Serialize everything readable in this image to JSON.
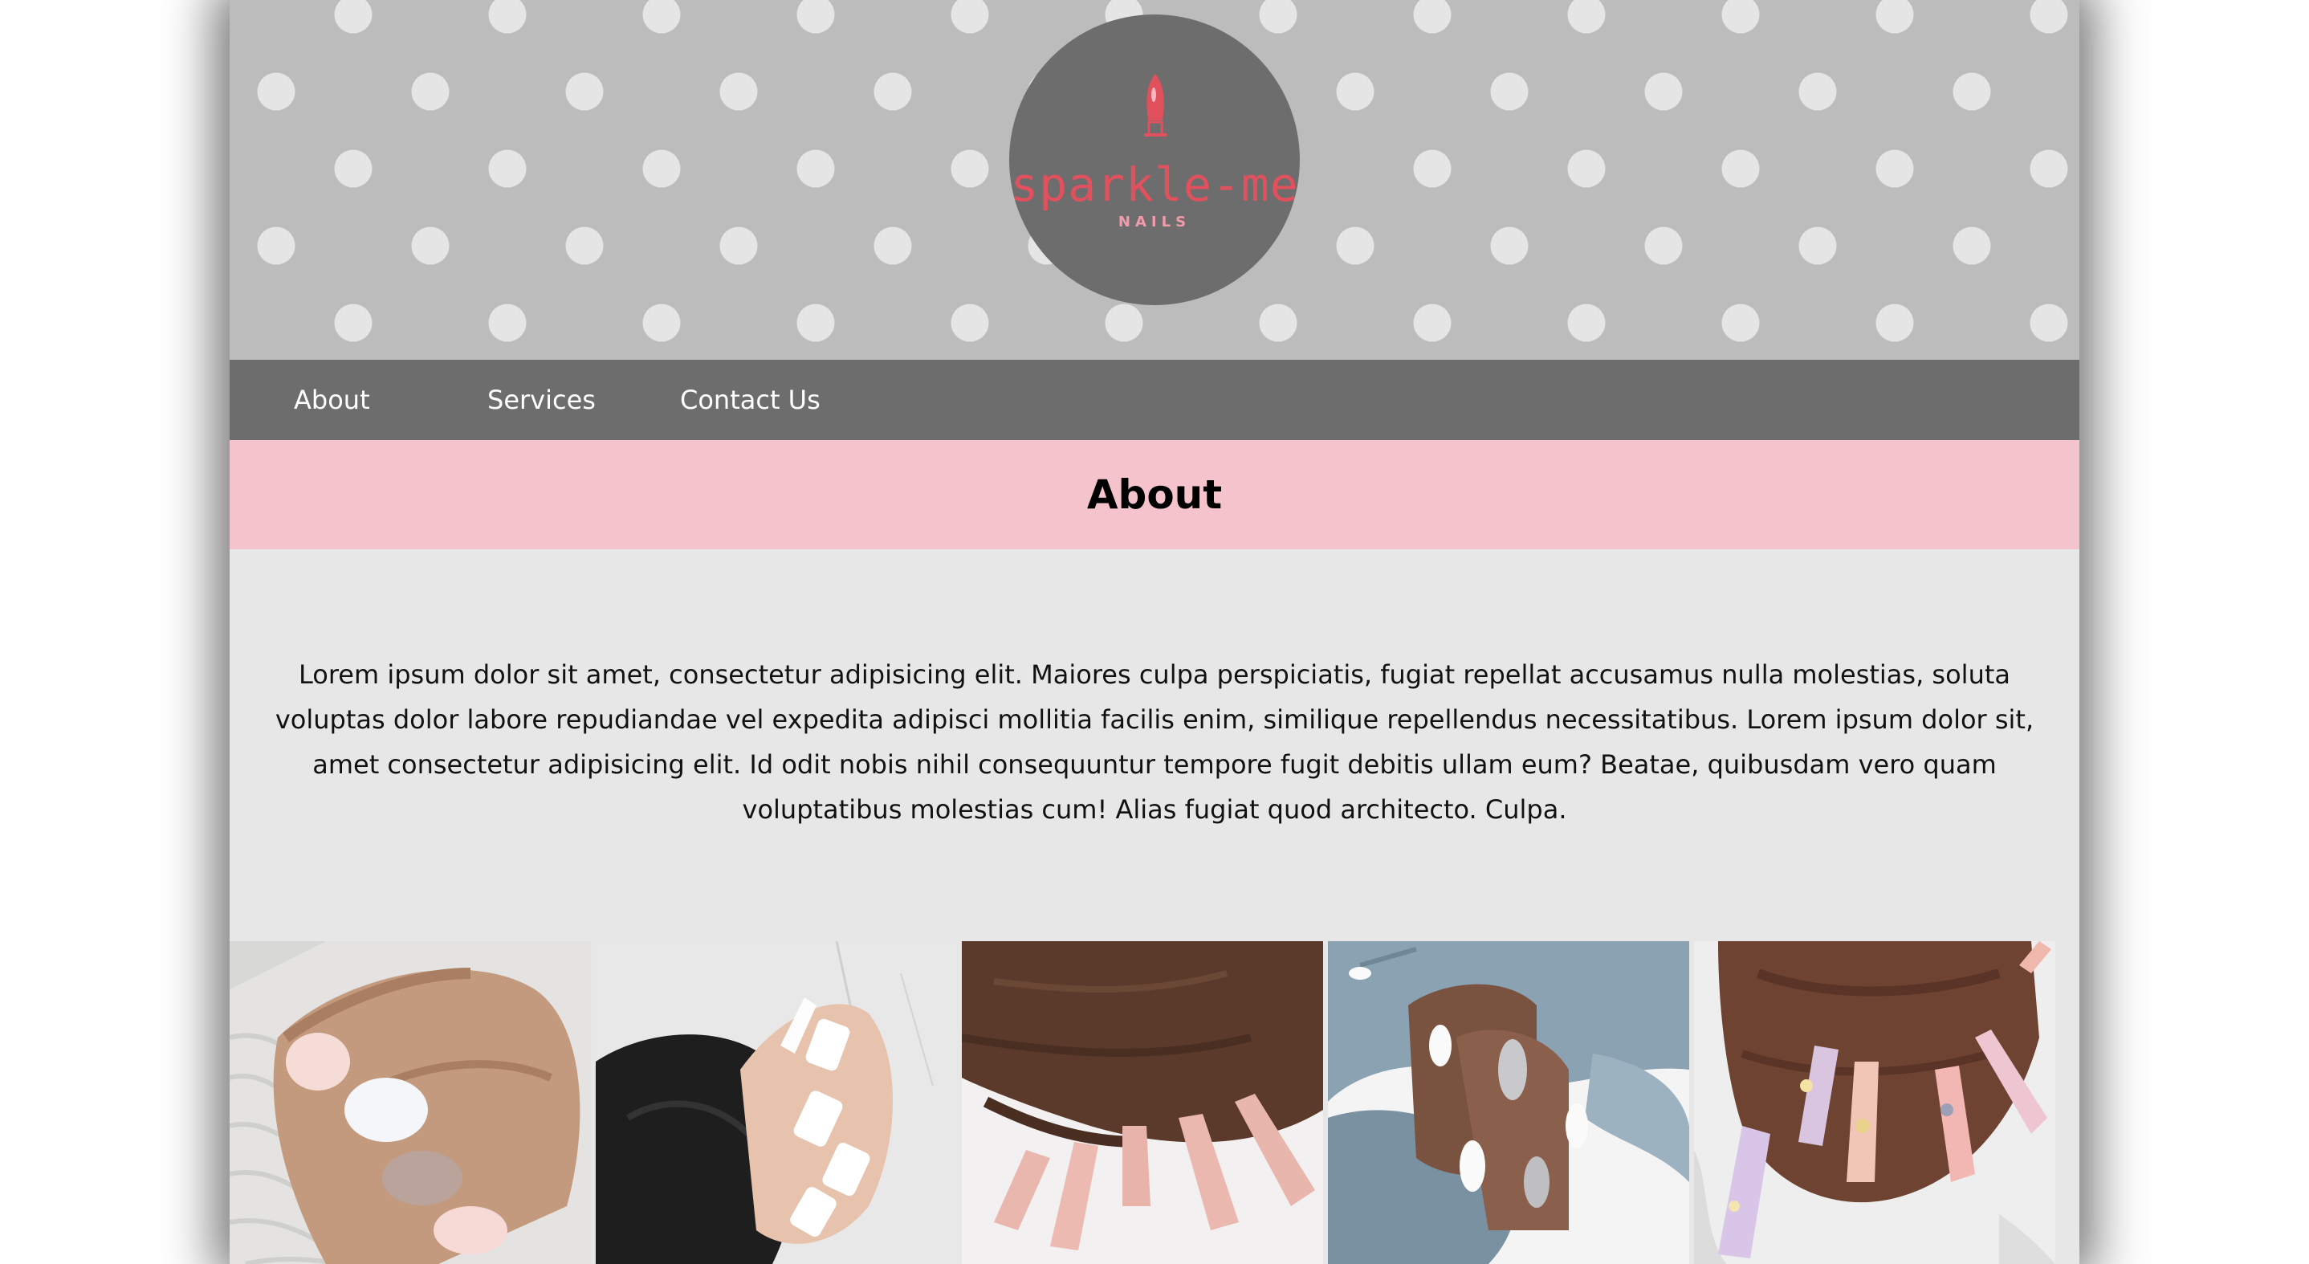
{
  "brand": {
    "name": "sparkle-me",
    "tagline": "NAILS",
    "colors": {
      "accent": "#e0505d",
      "pink_band": "#f5c3cc",
      "nav": "#6e6d6e",
      "header": "#bdbcbd"
    }
  },
  "nav": {
    "items": [
      {
        "label": "About"
      },
      {
        "label": "Services"
      },
      {
        "label": "Contact Us"
      }
    ]
  },
  "about": {
    "heading": "About",
    "body": "Lorem ipsum dolor sit amet, consectetur adipisicing elit. Maiores culpa perspiciatis, fugiat repellat accusamus nulla molestias, soluta voluptas dolor labore repudiandae vel expedita adipisci mollitia facilis enim, similique repellendus necessitatibus. Lorem ipsum dolor sit, amet consectetur adipisicing elit. Id odit nobis nihil consequuntur tempore fugit debitis ullam eum? Beatae, quibusdam vero quam voluptatibus molestias cum! Alias fugiat quod architecto. Culpa."
  },
  "gallery": {
    "images": [
      {
        "icon": "nail-photo-pastel-short"
      },
      {
        "icon": "nail-photo-white-coffin"
      },
      {
        "icon": "nail-photo-nude-coffin"
      },
      {
        "icon": "nail-photo-white-silver-glitter"
      },
      {
        "icon": "nail-photo-pink-gold-glitter"
      }
    ]
  }
}
